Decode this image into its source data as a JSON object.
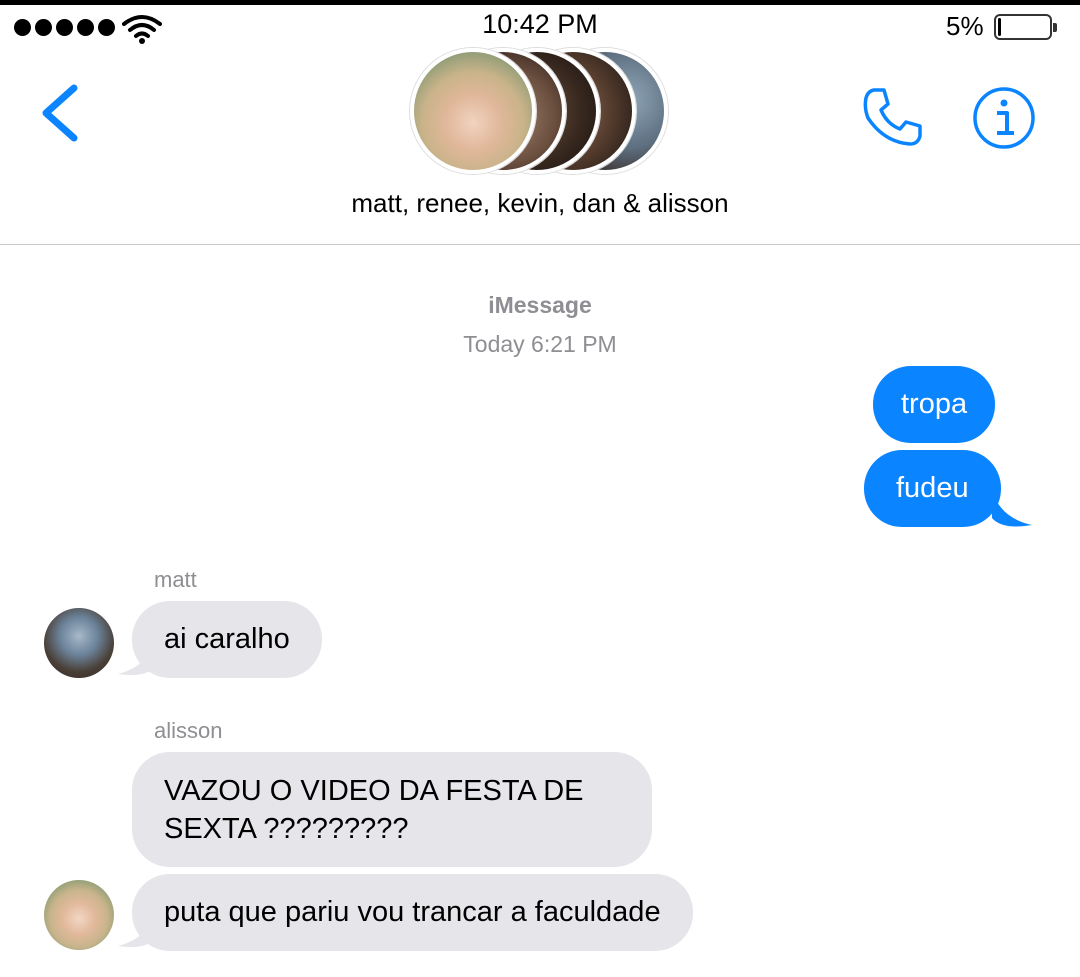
{
  "status_bar": {
    "time": "10:42 PM",
    "battery_percent": "5%",
    "battery_level": 0.05,
    "signal_bars": 5,
    "icons": [
      "signal-dots-icon",
      "wifi-icon",
      "battery-icon"
    ]
  },
  "header": {
    "group_name": "matt, renee, kevin, dan & alisson",
    "icons": [
      "chevron-left-icon",
      "phone-icon",
      "info-icon"
    ],
    "colors": {
      "accent": "#0a84ff"
    }
  },
  "chat": {
    "service_label": "iMessage",
    "timestamp": "Today 6:21 PM",
    "messages": [
      {
        "direction": "sent",
        "text": "tropa"
      },
      {
        "direction": "sent",
        "text": "fudeu"
      },
      {
        "direction": "received",
        "sender": "matt",
        "text": "ai caralho"
      },
      {
        "direction": "received",
        "sender": "alisson",
        "text_lines": [
          "VAZOU O VIDEO DA FESTA DE",
          "SEXTA ?????????"
        ]
      },
      {
        "direction": "received",
        "sender": "alisson",
        "text": "puta que pariu vou trancar a faculdade"
      }
    ]
  },
  "colors": {
    "sent_bubble": "#0a84ff",
    "received_bubble": "#e5e5ea",
    "meta_text": "#8e8e93",
    "divider": "#c8c7cc"
  }
}
